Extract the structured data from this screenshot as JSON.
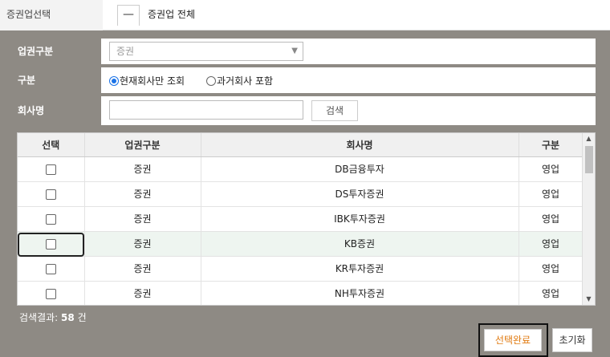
{
  "top": {
    "label": "증권업선택",
    "toggle_symbol": "—",
    "value": "증권업 전체"
  },
  "filters": {
    "category": {
      "label": "업권구분",
      "value": "증권"
    },
    "type": {
      "label": "구분",
      "options": [
        "현재회사만 조회",
        "과거회사 포함"
      ],
      "selected_index": 0
    },
    "company": {
      "label": "회사명",
      "value": "",
      "search_label": "검색"
    }
  },
  "table": {
    "headers": [
      "선택",
      "업권구분",
      "회사명",
      "구분"
    ],
    "rows": [
      {
        "category": "증권",
        "company": "DB금융투자",
        "type": "영업"
      },
      {
        "category": "증권",
        "company": "DS투자증권",
        "type": "영업"
      },
      {
        "category": "증권",
        "company": "IBK투자증권",
        "type": "영업"
      },
      {
        "category": "증권",
        "company": "KB증권",
        "type": "영업"
      },
      {
        "category": "증권",
        "company": "KR투자증권",
        "type": "영업"
      },
      {
        "category": "증권",
        "company": "NH투자증권",
        "type": "영업"
      }
    ],
    "highlighted_row": 3
  },
  "result": {
    "prefix": "검색결과:",
    "count": "58",
    "unit": "건"
  },
  "actions": {
    "done_label": "선택완료",
    "reset_label": "초기화"
  }
}
